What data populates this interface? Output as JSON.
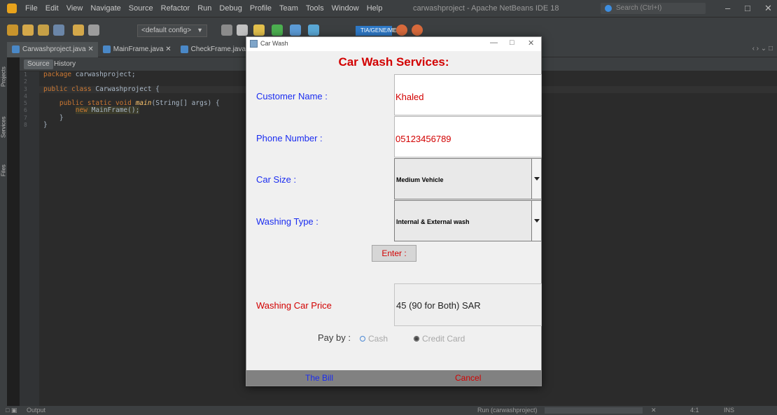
{
  "ide": {
    "menu": [
      "File",
      "Edit",
      "View",
      "Navigate",
      "Source",
      "Refactor",
      "Run",
      "Debug",
      "Profile",
      "Team",
      "Tools",
      "Window",
      "Help"
    ],
    "window_title": "carwashproject - Apache NetBeans IDE 18",
    "search_placeholder": "Search (Ctrl+I)",
    "config": "<default config>",
    "memory": "TIA/GENE/ME",
    "side_tabs": [
      "Projects",
      "Services",
      "Files"
    ],
    "editor_tabs": [
      "Carwashproject.java",
      "MainFrame.java",
      "CheckFrame.java"
    ],
    "source_tabs": [
      "Source",
      "History"
    ],
    "line_numbers": [
      "1",
      "2",
      "3",
      "4",
      "5",
      "6",
      "7",
      "8"
    ],
    "code": {
      "l1_kw": "package",
      "l1_rest": " carwashproject;",
      "l3_kw": "public class",
      "l3_rest": " Carwashproject {",
      "l5_kw": "public static void",
      "l5_fn": "main",
      "l5_rest": "(String[] args) {",
      "l6_kw": "new",
      "l6_rest": " MainFrame();",
      "l7": "}",
      "l8": "}"
    },
    "status": {
      "output": "Output",
      "run_label": "Run (carwashproject)",
      "position": "4:1",
      "mode": "INS"
    }
  },
  "dialog": {
    "title": "Car Wash",
    "heading": "Car Wash Services:",
    "customer_label": "Customer Name :",
    "customer_value": "Khaled",
    "phone_label": "Phone Number :",
    "phone_value": "05123456789",
    "size_label": "Car Size :",
    "size_value": "Medium Vehicle",
    "wash_label": "Washing Type :",
    "wash_value": "Internal & External wash",
    "enter_label": "Enter :",
    "price_label": "Washing Car Price",
    "price_value": "45 (90 for Both) SAR",
    "pay_label": "Pay by :",
    "cash_label": "Cash",
    "card_label": "Credit Card",
    "bill_label": "The Bill",
    "cancel_label": "Cancel"
  },
  "colors": {
    "accent_red": "#d20000",
    "label_blue": "#1a2cf0",
    "ide_bg": "#2b2b2b"
  }
}
